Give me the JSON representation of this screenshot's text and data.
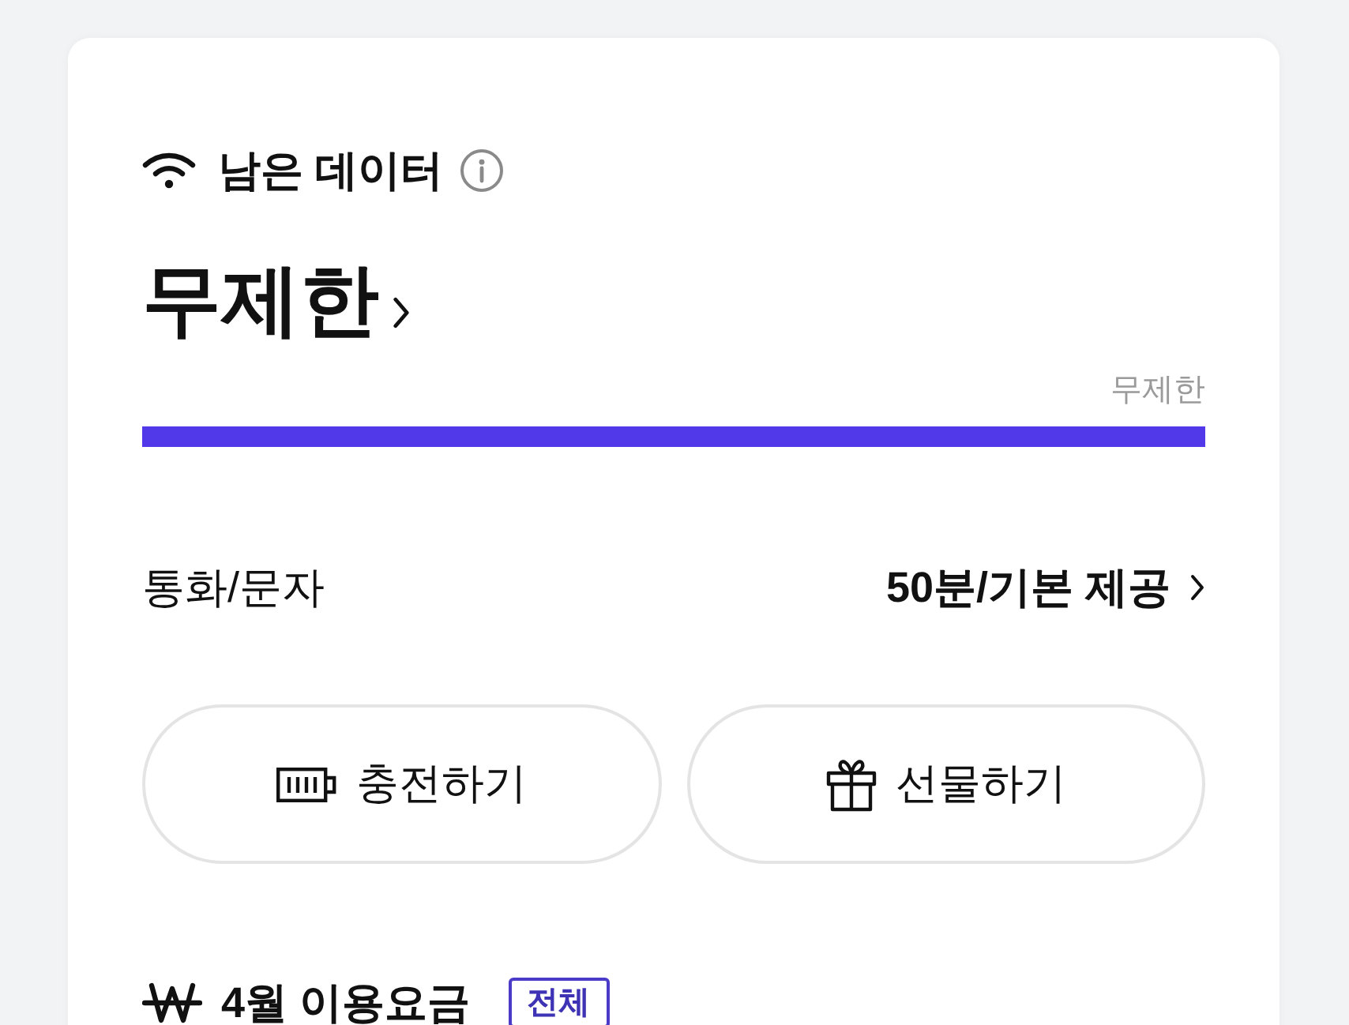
{
  "data": {
    "title": "남은 데이터",
    "value": "무제한",
    "bar_label": "무제한",
    "level": 1
  },
  "calls": {
    "label": "통화/문자",
    "value": "50분/기본 제공"
  },
  "buttons": [
    {
      "kind": "charge",
      "label": "충전하기"
    },
    {
      "kind": "gift",
      "label": "선물하기"
    }
  ],
  "bill": {
    "title": "4월 이용요금",
    "badge": "전체"
  }
}
